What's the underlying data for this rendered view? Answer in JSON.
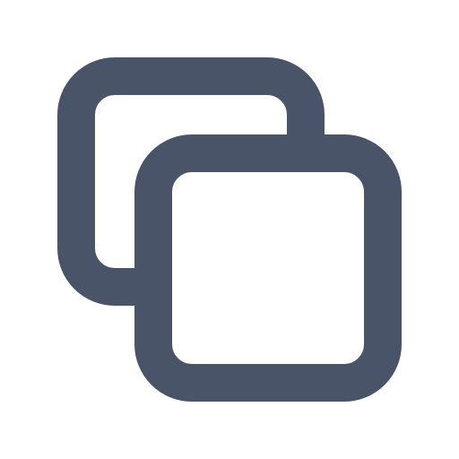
{
  "icon": {
    "name": "copy-icon",
    "stroke_color": "#4a5468",
    "background_color": "#ffffff"
  }
}
